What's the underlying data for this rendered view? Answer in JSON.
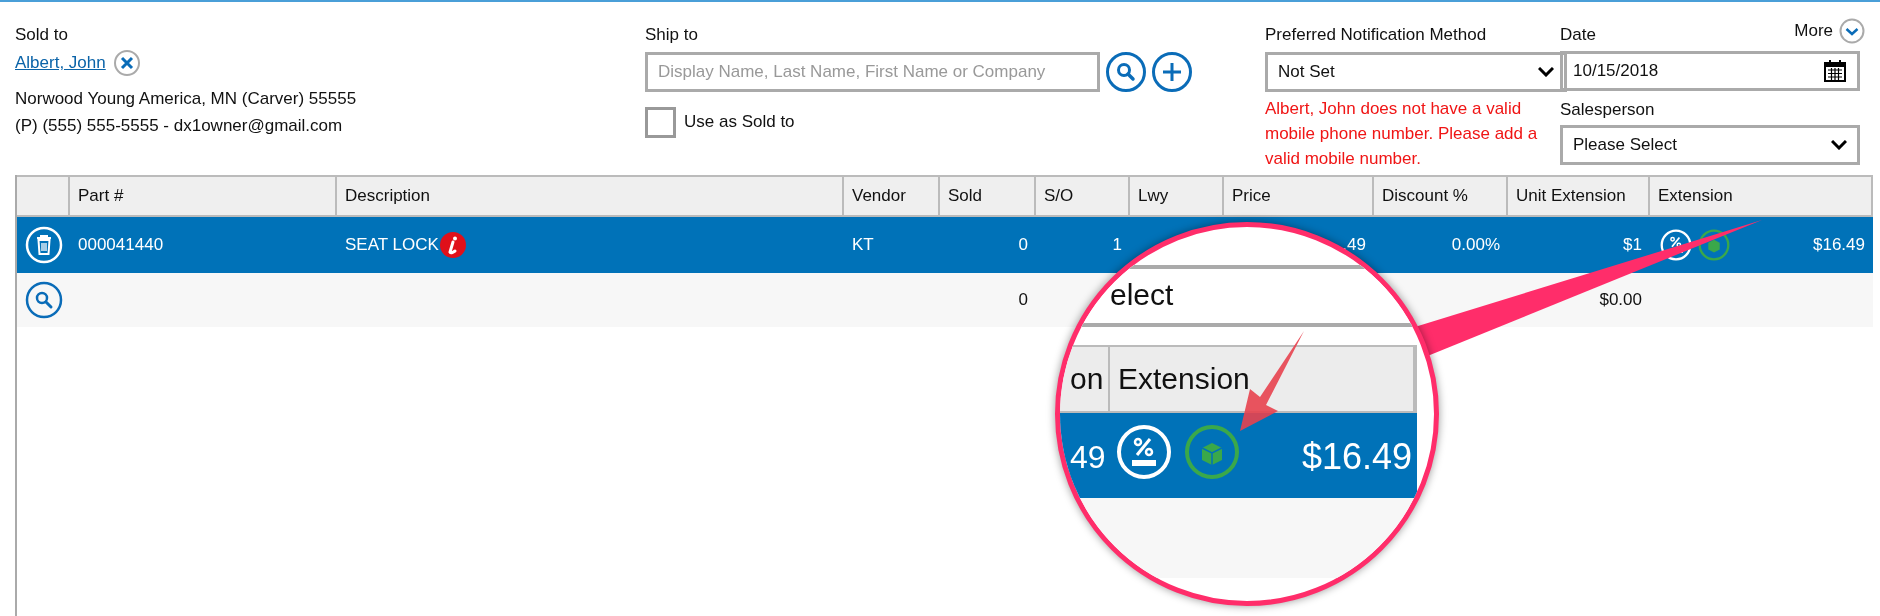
{
  "sold_to": {
    "label": "Sold to",
    "name": "Albert, John",
    "address": "Norwood Young America, MN (Carver) 55555",
    "contact": "(P) (555) 555-5555 - dx1owner@gmail.com"
  },
  "ship_to": {
    "label": "Ship to",
    "placeholder": "Display Name, Last Name, First Name or Company",
    "use_as_sold_to": {
      "label": "Use as Sold to",
      "checked": false
    }
  },
  "notification": {
    "label": "Preferred Notification Method",
    "value": "Not Set",
    "error": "Albert, John does not have a valid mobile phone number. Please add a valid mobile number."
  },
  "date": {
    "label": "Date",
    "value": "10/15/2018"
  },
  "more": "More",
  "salesperson": {
    "label": "Salesperson",
    "value": "Please Select"
  },
  "table": {
    "columns": [
      "Part #",
      "Description",
      "Vendor",
      "Sold",
      "S/O",
      "Lwy",
      "Price",
      "Discount %",
      "Unit Extension",
      "Extension"
    ],
    "rows": [
      {
        "kind": "item",
        "selected": true,
        "info": true,
        "taxable": true,
        "in_stock": true,
        "part": "000041440",
        "description": "SEAT LOCK",
        "vendor": "KT",
        "sold": "0",
        "s_o": "1",
        "price": ".49",
        "discount": "0.00%",
        "unit_extension": "$1",
        "extension": "$16.49"
      },
      {
        "kind": "new",
        "selected": false,
        "info": false,
        "taxable": false,
        "in_stock": false,
        "sold": "0",
        "unit_extension": "$0.00"
      }
    ]
  },
  "magnifier": {
    "dropdown_text": "elect",
    "header_fragment": "on",
    "header": "Extension",
    "price_fragment": "49",
    "extension": "$16.49"
  }
}
